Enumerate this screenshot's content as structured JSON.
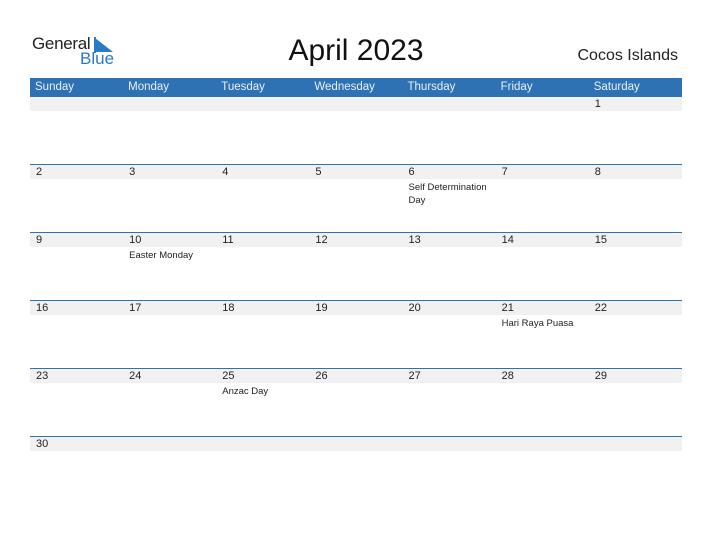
{
  "logo": {
    "general": "General",
    "blue": "Blue"
  },
  "header": {
    "title": "April 2023",
    "region": "Cocos Islands"
  },
  "colors": {
    "accent": "#2e72b3",
    "band": "#f1f1f1"
  },
  "days": [
    "Sunday",
    "Monday",
    "Tuesday",
    "Wednesday",
    "Thursday",
    "Friday",
    "Saturday"
  ],
  "weeks": [
    [
      {
        "d": ""
      },
      {
        "d": ""
      },
      {
        "d": ""
      },
      {
        "d": ""
      },
      {
        "d": ""
      },
      {
        "d": ""
      },
      {
        "d": "1"
      }
    ],
    [
      {
        "d": "2"
      },
      {
        "d": "3"
      },
      {
        "d": "4"
      },
      {
        "d": "5"
      },
      {
        "d": "6",
        "e": "Self Determination Day"
      },
      {
        "d": "7"
      },
      {
        "d": "8"
      }
    ],
    [
      {
        "d": "9"
      },
      {
        "d": "10",
        "e": "Easter Monday"
      },
      {
        "d": "11"
      },
      {
        "d": "12"
      },
      {
        "d": "13"
      },
      {
        "d": "14"
      },
      {
        "d": "15"
      }
    ],
    [
      {
        "d": "16"
      },
      {
        "d": "17"
      },
      {
        "d": "18"
      },
      {
        "d": "19"
      },
      {
        "d": "20"
      },
      {
        "d": "21",
        "e": "Hari Raya Puasa"
      },
      {
        "d": "22"
      }
    ],
    [
      {
        "d": "23"
      },
      {
        "d": "24"
      },
      {
        "d": "25",
        "e": "Anzac Day"
      },
      {
        "d": "26"
      },
      {
        "d": "27"
      },
      {
        "d": "28"
      },
      {
        "d": "29"
      }
    ],
    [
      {
        "d": "30"
      },
      {
        "d": ""
      },
      {
        "d": ""
      },
      {
        "d": ""
      },
      {
        "d": ""
      },
      {
        "d": ""
      },
      {
        "d": ""
      }
    ]
  ]
}
